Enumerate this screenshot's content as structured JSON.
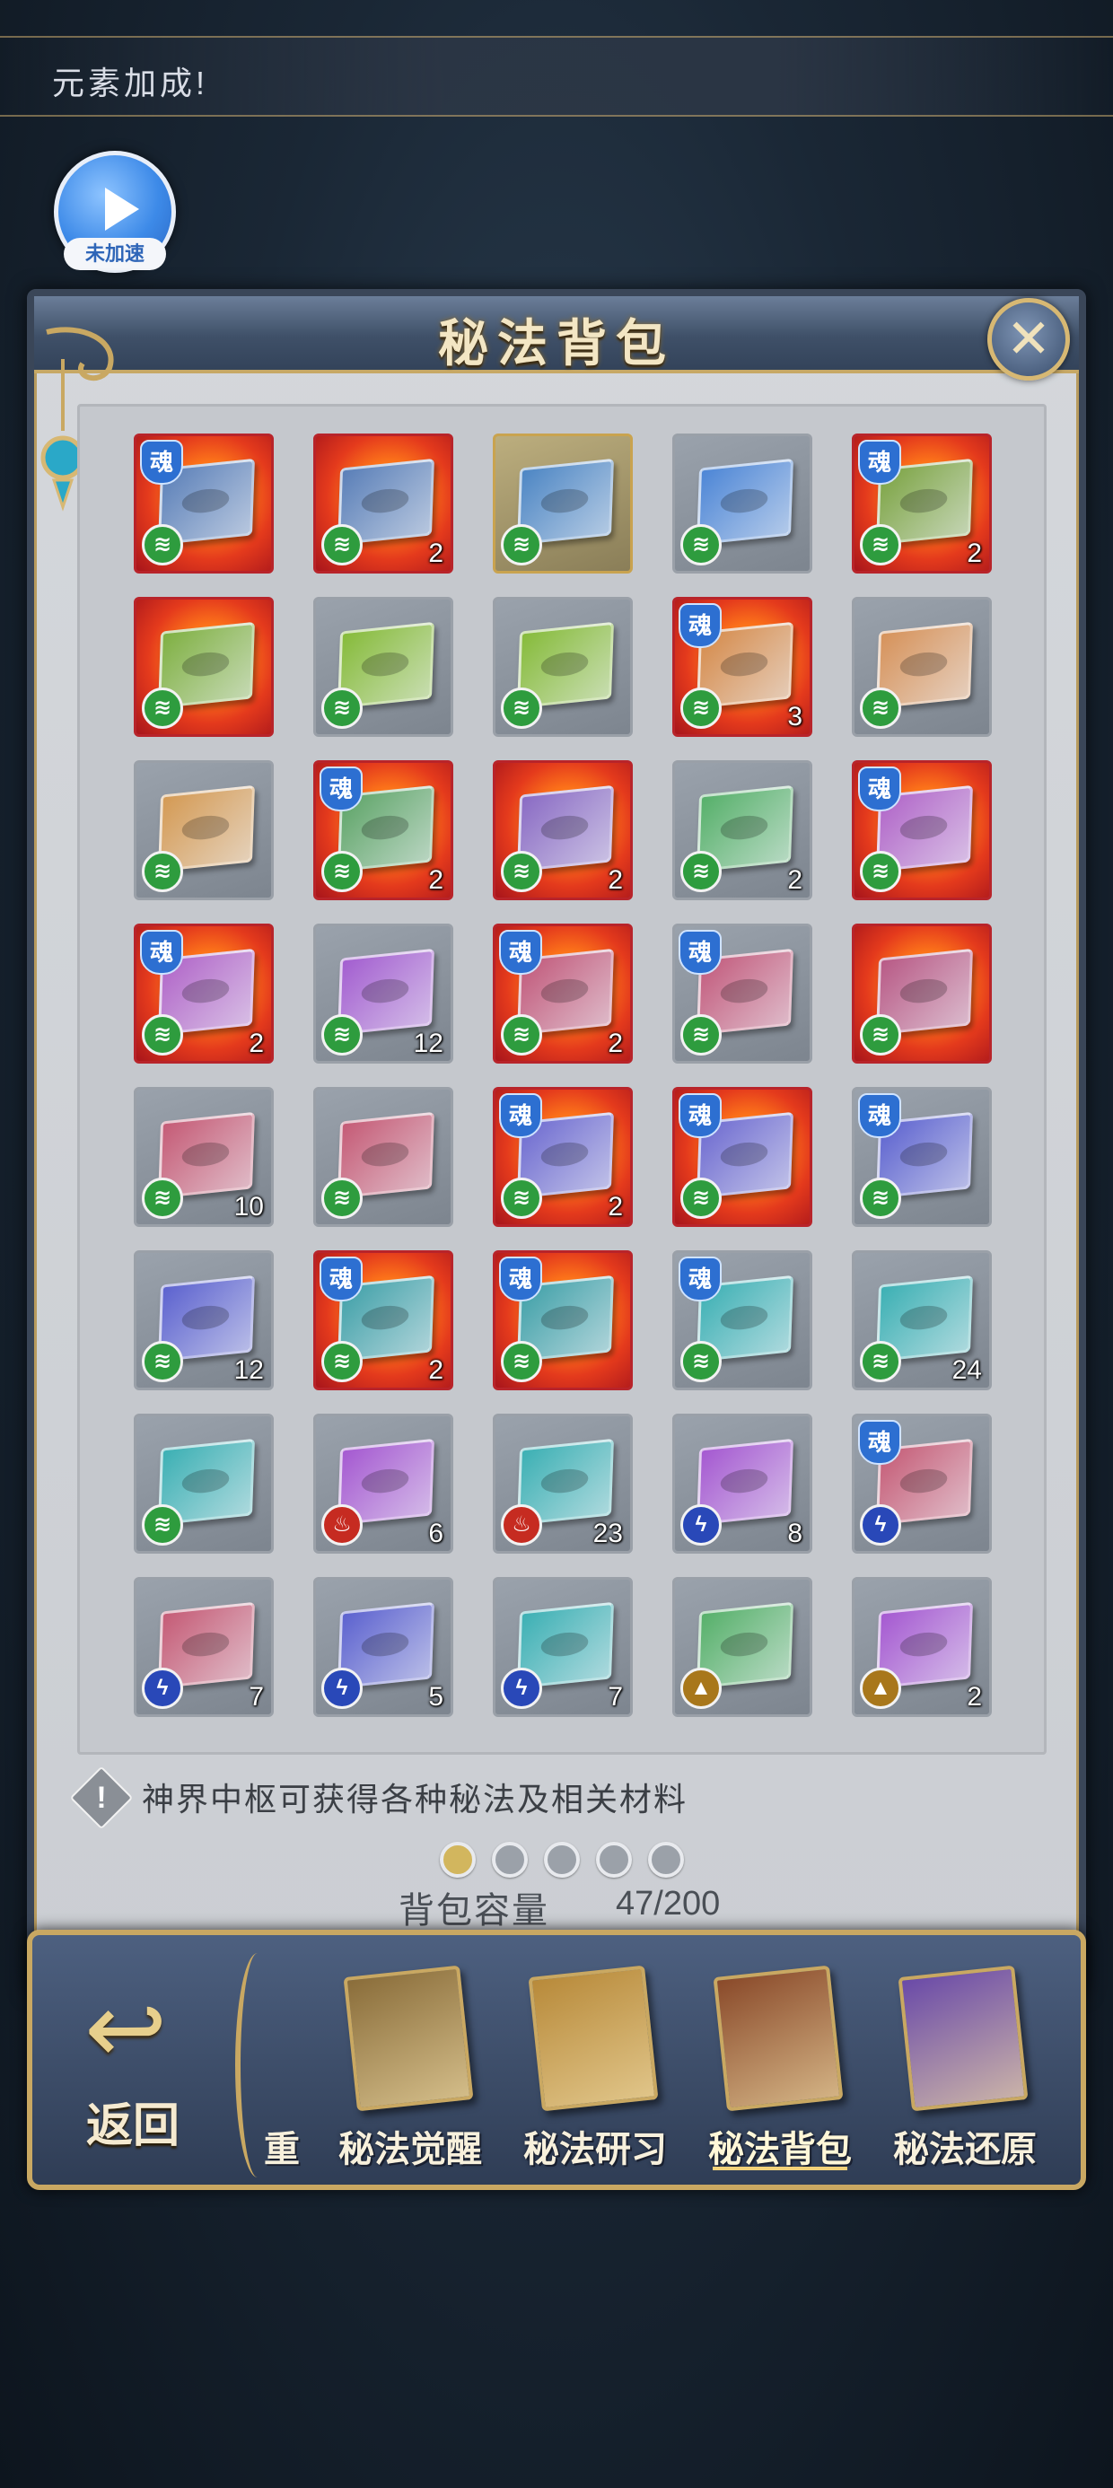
{
  "banner": {
    "text": "元素加成!"
  },
  "speed_button": {
    "label": "未加速",
    "icon": "play-icon"
  },
  "panel": {
    "title": "秘法背包",
    "close_icon": "close-icon",
    "tip": "神界中枢可获得各种秘法及相关材料",
    "page_count": 5,
    "active_page": 1,
    "capacity_label": "背包容量",
    "capacity_value": "47/200"
  },
  "inventory": [
    {
      "color": "#5a7fb8",
      "fire": true,
      "soul": true,
      "element": "wind",
      "count": ""
    },
    {
      "color": "#5a7fb8",
      "fire": true,
      "soul": false,
      "element": "wind",
      "count": "2"
    },
    {
      "color": "#4d86c4",
      "fire": false,
      "soul": false,
      "element": "wind",
      "count": "",
      "gold": true
    },
    {
      "color": "#4d86d6",
      "fire": false,
      "soul": false,
      "element": "wind",
      "count": ""
    },
    {
      "color": "#7ba342",
      "fire": true,
      "soul": true,
      "element": "wind",
      "count": "2"
    },
    {
      "color": "#7fb042",
      "fire": true,
      "soul": false,
      "element": "wind",
      "count": ""
    },
    {
      "color": "#86bb3a",
      "fire": false,
      "soul": false,
      "element": "wind",
      "count": ""
    },
    {
      "color": "#86bb3a",
      "fire": false,
      "soul": false,
      "element": "wind",
      "count": ""
    },
    {
      "color": "#d58a4a",
      "fire": true,
      "soul": true,
      "element": "wind",
      "count": "3"
    },
    {
      "color": "#d6925a",
      "fire": false,
      "soul": false,
      "element": "wind",
      "count": ""
    },
    {
      "color": "#d49a54",
      "fire": false,
      "soul": false,
      "element": "wind",
      "count": ""
    },
    {
      "color": "#5da467",
      "fire": true,
      "soul": true,
      "element": "wind",
      "count": "2"
    },
    {
      "color": "#8a6bc4",
      "fire": true,
      "soul": false,
      "element": "wind",
      "count": "2"
    },
    {
      "color": "#56b06a",
      "fire": false,
      "soul": false,
      "element": "wind",
      "count": "2"
    },
    {
      "color": "#b064c8",
      "fire": true,
      "soul": true,
      "element": "wind",
      "count": ""
    },
    {
      "color": "#b064c8",
      "fire": true,
      "soul": true,
      "element": "wind",
      "count": "2"
    },
    {
      "color": "#a35ed0",
      "fire": false,
      "soul": false,
      "element": "wind",
      "count": "12"
    },
    {
      "color": "#c1587a",
      "fire": true,
      "soul": true,
      "element": "wind",
      "count": "2"
    },
    {
      "color": "#c25a7c",
      "fire": false,
      "soul": true,
      "element": "wind",
      "count": ""
    },
    {
      "color": "#b85a86",
      "fire": true,
      "soul": false,
      "element": "wind",
      "count": ""
    },
    {
      "color": "#c55b76",
      "fire": false,
      "soul": false,
      "element": "wind",
      "count": "10"
    },
    {
      "color": "#c55b76",
      "fire": false,
      "soul": false,
      "element": "wind",
      "count": ""
    },
    {
      "color": "#6d6ad0",
      "fire": true,
      "soul": true,
      "element": "wind",
      "count": "2"
    },
    {
      "color": "#6d6ad0",
      "fire": true,
      "soul": true,
      "element": "wind",
      "count": ""
    },
    {
      "color": "#5c62cf",
      "fire": false,
      "soul": true,
      "element": "wind",
      "count": ""
    },
    {
      "color": "#5c62cf",
      "fire": false,
      "soul": false,
      "element": "wind",
      "count": "12"
    },
    {
      "color": "#3fa0a8",
      "fire": true,
      "soul": true,
      "element": "wind",
      "count": "2"
    },
    {
      "color": "#3fa0a8",
      "fire": true,
      "soul": true,
      "element": "wind",
      "count": ""
    },
    {
      "color": "#3cb0b4",
      "fire": false,
      "soul": true,
      "element": "wind",
      "count": ""
    },
    {
      "color": "#3cb0b4",
      "fire": false,
      "soul": false,
      "element": "wind",
      "count": "24"
    },
    {
      "color": "#3cb0b4",
      "fire": false,
      "soul": false,
      "element": "wind",
      "count": ""
    },
    {
      "color": "#a559d1",
      "fire": false,
      "soul": false,
      "element": "fireel",
      "count": "6"
    },
    {
      "color": "#3cb0b4",
      "fire": false,
      "soul": false,
      "element": "fireel",
      "count": "23"
    },
    {
      "color": "#a559d1",
      "fire": false,
      "soul": false,
      "element": "thunder",
      "count": "8"
    },
    {
      "color": "#c55b76",
      "fire": false,
      "soul": true,
      "element": "thunder",
      "count": ""
    },
    {
      "color": "#c55b76",
      "fire": false,
      "soul": false,
      "element": "thunder",
      "count": "7"
    },
    {
      "color": "#5c62cf",
      "fire": false,
      "soul": false,
      "element": "thunder",
      "count": "5"
    },
    {
      "color": "#3cb0b4",
      "fire": false,
      "soul": false,
      "element": "thunder",
      "count": "7"
    },
    {
      "color": "#56b06a",
      "fire": false,
      "soul": false,
      "element": "earth",
      "count": ""
    },
    {
      "color": "#a559d1",
      "fire": false,
      "soul": false,
      "element": "earth",
      "count": "2"
    }
  ],
  "soul_glyph": "魂",
  "element_glyphs": {
    "wind": "≋",
    "fireel": "♨",
    "thunder": "ϟ",
    "earth": "▲"
  },
  "bottom_nav": {
    "back_label": "返回",
    "partial_label": "重",
    "items": [
      {
        "label": "秘法觉醒",
        "art": "#8a6d3a",
        "active": false
      },
      {
        "label": "秘法研习",
        "art": "#b88a3a",
        "active": false
      },
      {
        "label": "秘法背包",
        "art": "#8a4a2a",
        "active": true
      },
      {
        "label": "秘法还原",
        "art": "#6a4aa8",
        "active": false
      }
    ]
  }
}
